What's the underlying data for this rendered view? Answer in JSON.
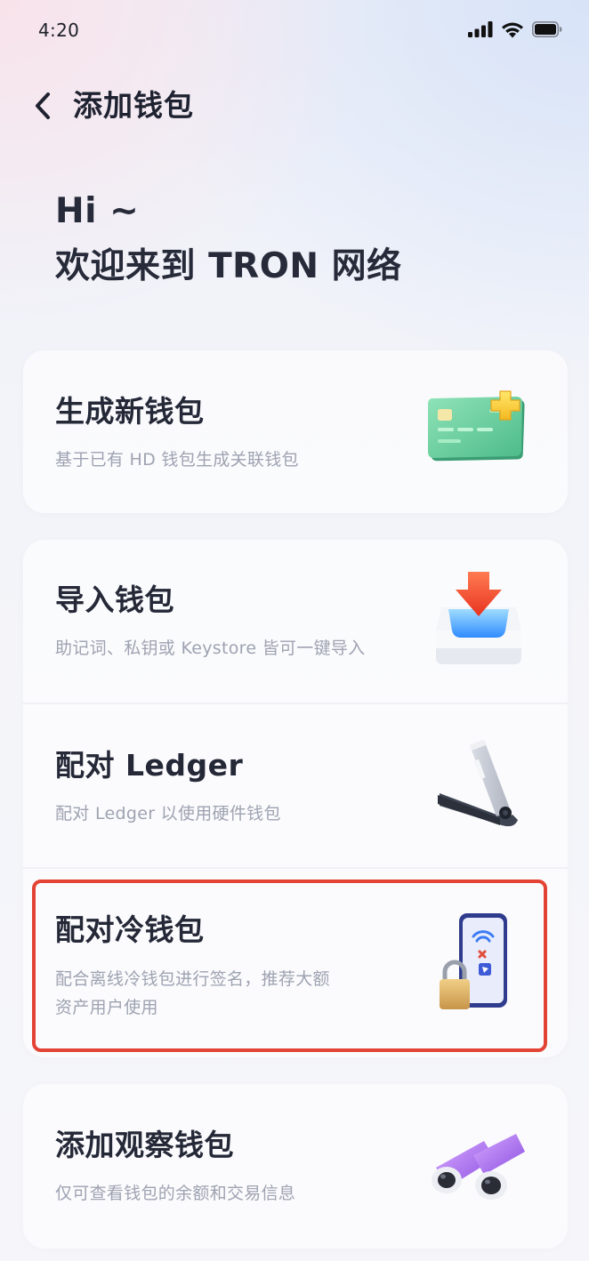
{
  "status_bar": {
    "time": "4:20",
    "icons": [
      "cellular-signal-icon",
      "wifi-icon",
      "battery-icon"
    ]
  },
  "header": {
    "back_icon": "chevron-left-icon",
    "title": "添加钱包"
  },
  "greeting": {
    "line1": "Hi ~",
    "line2": "欢迎来到 TRON 网络"
  },
  "options": {
    "generate": {
      "title": "生成新钱包",
      "description": "基于已有 HD 钱包生成关联钱包",
      "icon": "card-plus-icon"
    },
    "import": {
      "title": "导入钱包",
      "description": "助记词、私钥或 Keystore 皆可一键导入",
      "icon": "import-tray-icon"
    },
    "ledger": {
      "title": "配对 Ledger",
      "description": "配对 Ledger 以使用硬件钱包",
      "icon": "ledger-device-icon"
    },
    "cold": {
      "title": "配对冷钱包",
      "description_line1": "配合离线冷钱包进行签名，推荐大额",
      "description_line2": "资产用户使用",
      "icon": "phone-lock-icon"
    },
    "watch": {
      "title": "添加观察钱包",
      "description": "仅可查看钱包的余额和交易信息",
      "icon": "binoculars-icon"
    }
  },
  "colors": {
    "highlight_border": "#e34334",
    "title_text": "#242837",
    "description_text": "#9ea3b1"
  }
}
